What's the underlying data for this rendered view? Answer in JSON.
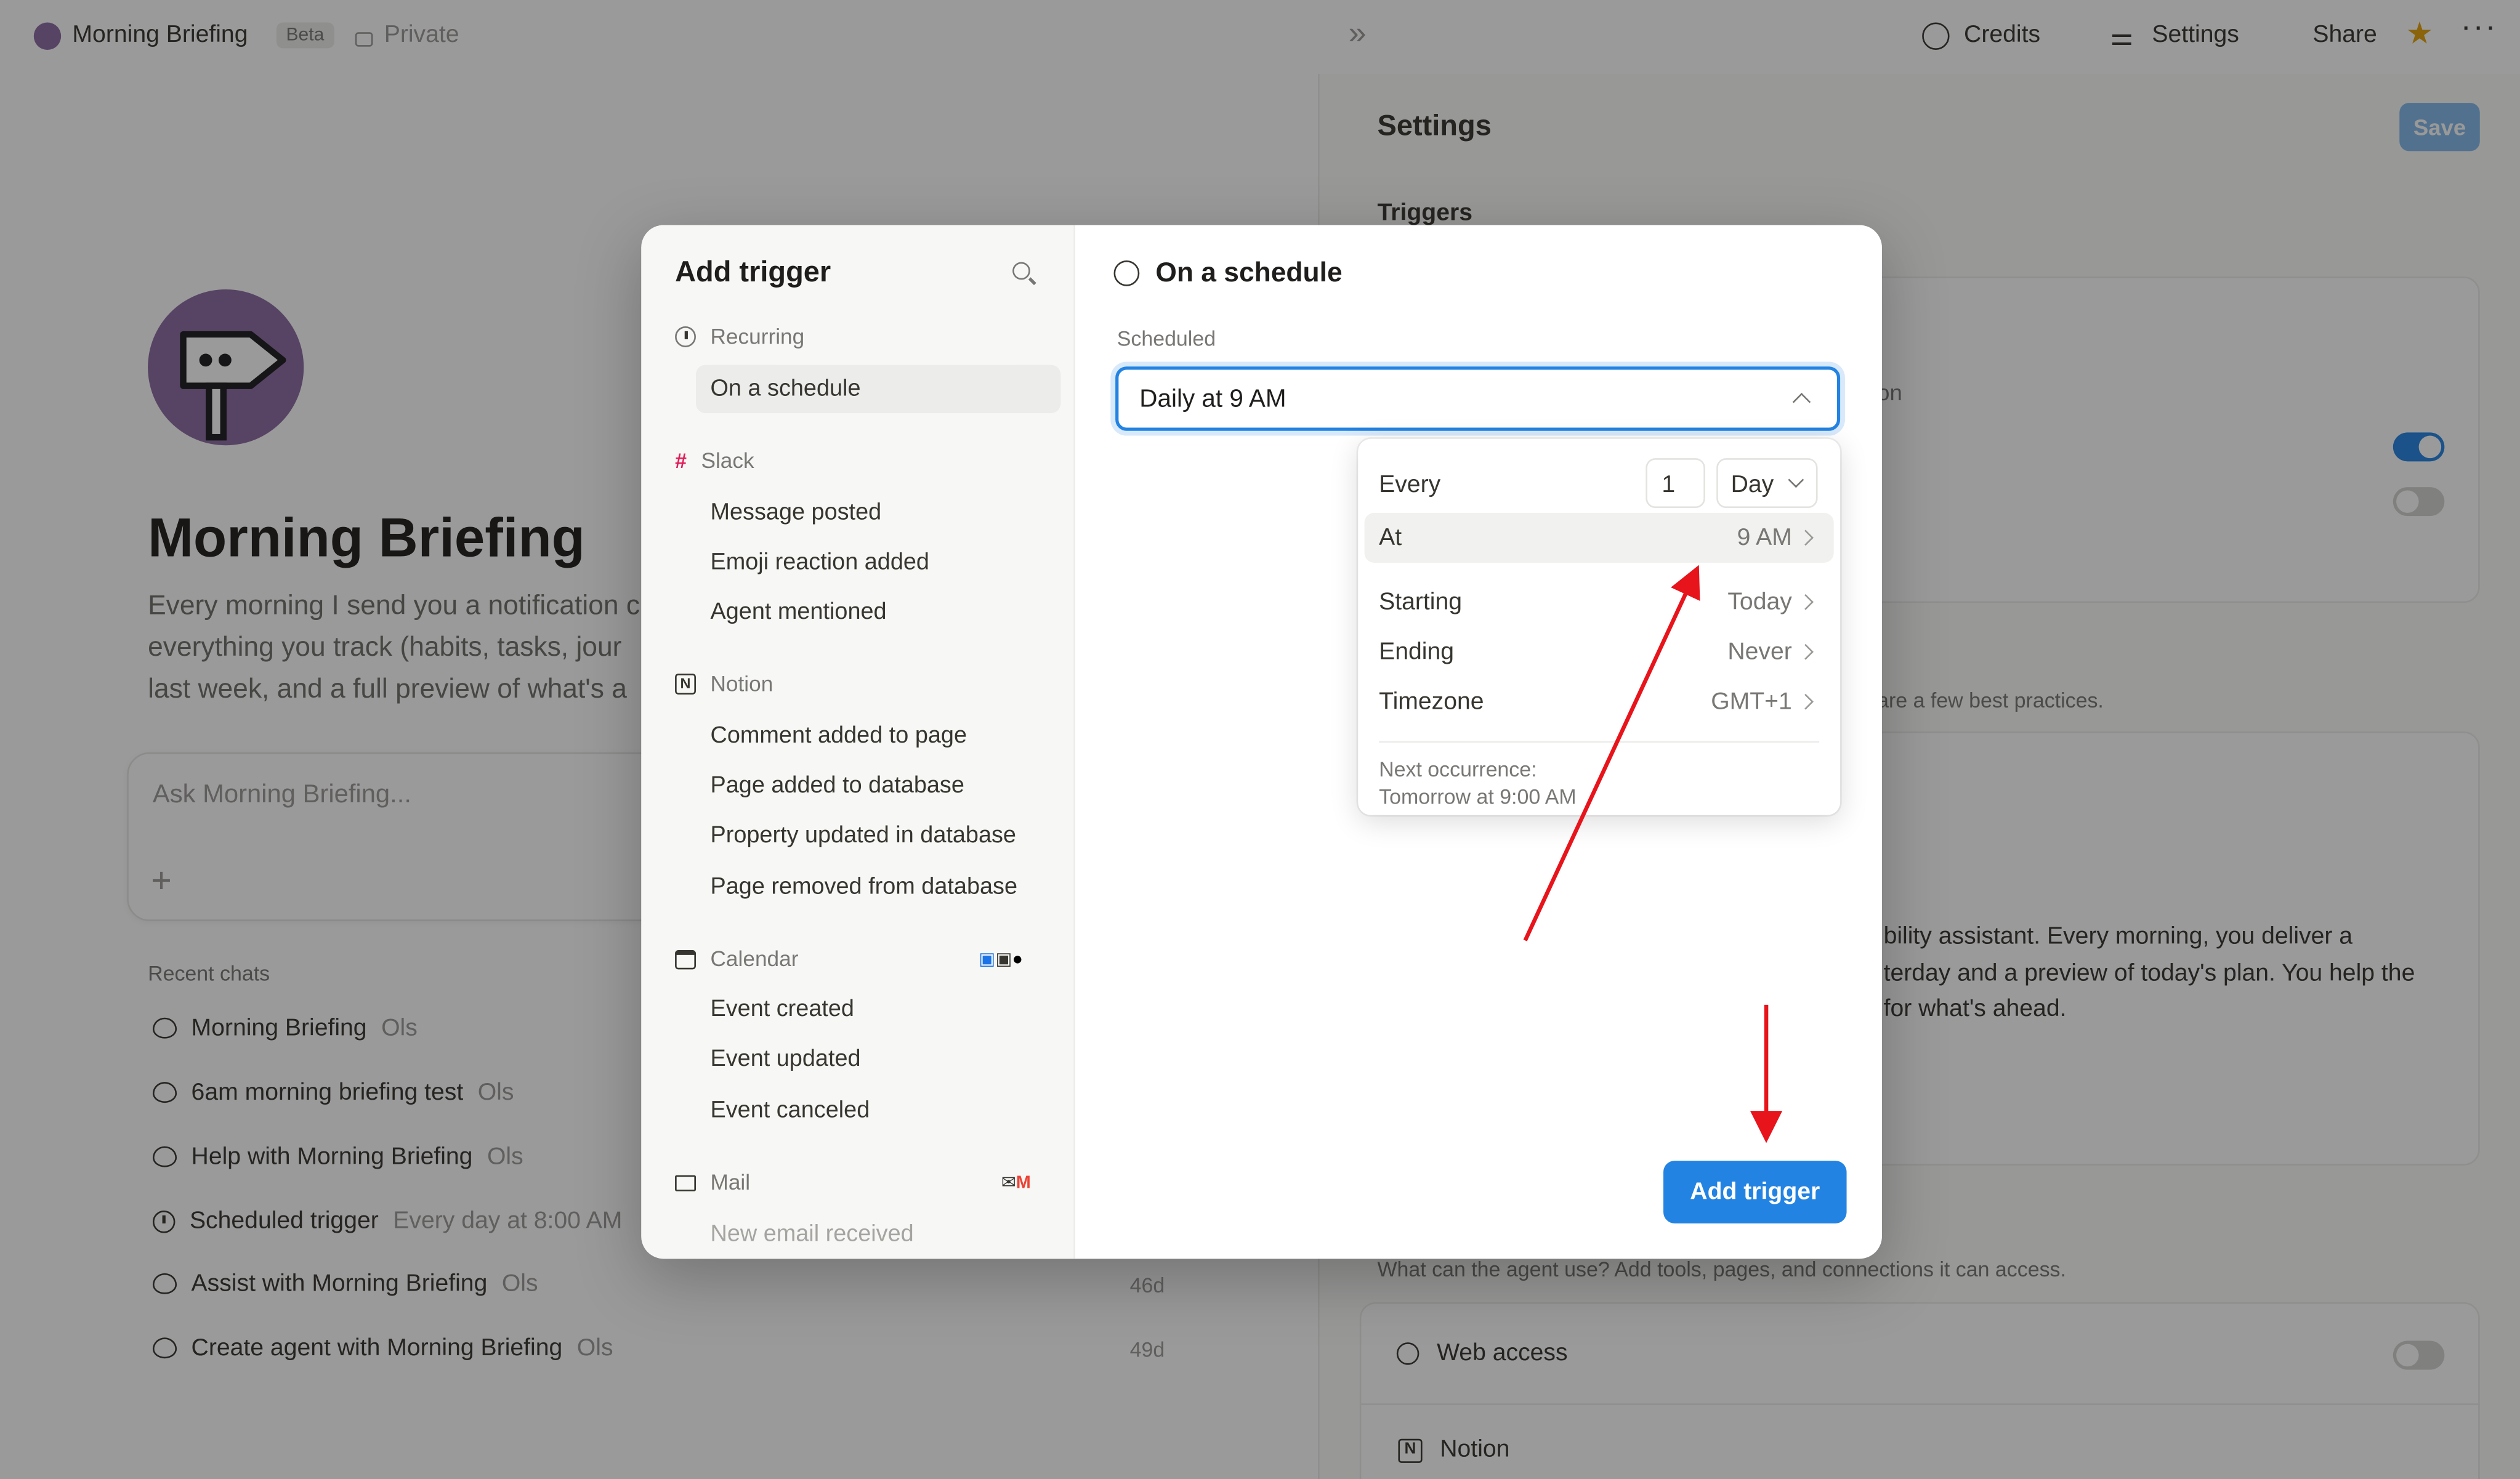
{
  "topbar": {
    "title": "Morning Briefing",
    "beta": "Beta",
    "privacy": "Private",
    "credits": "Credits",
    "settings": "Settings",
    "share": "Share"
  },
  "agent": {
    "name": "Morning Briefing",
    "description_lines": [
      "Every morning I send you a notification c",
      "everything you track (habits, tasks, jour",
      "last week, and a full preview of what's a"
    ],
    "ask_placeholder": "Ask Morning Briefing..."
  },
  "recent_chats": {
    "heading": "Recent chats",
    "items": [
      {
        "title": "Morning Briefing",
        "sub": "Ols",
        "age": "",
        "icon": "chat-bubble-icon"
      },
      {
        "title": "6am morning briefing test",
        "sub": "Ols",
        "age": "",
        "icon": "chat-bubble-icon"
      },
      {
        "title": "Help with Morning Briefing",
        "sub": "Ols",
        "age": "",
        "icon": "chat-bubble-icon"
      },
      {
        "title": "Scheduled trigger",
        "sub": "Every day at 8:00 AM",
        "age": "",
        "icon": "clock-icon"
      },
      {
        "title": "Assist with Morning Briefing",
        "sub": "Ols",
        "age": "46d",
        "icon": "chat-bubble-icon"
      },
      {
        "title": "Create agent with Morning Briefing",
        "sub": "Ols",
        "age": "49d",
        "icon": "chat-bubble-icon"
      }
    ]
  },
  "settings_panel": {
    "title": "Settings",
    "save": "Save",
    "triggers": "Triggers",
    "partial_on": "on",
    "best_practices": "are a few best practices.",
    "instruction_lines": [
      "bility assistant. Every morning, you deliver a",
      "terday and a preview of today's plan. You help the",
      "for what's ahead."
    ],
    "tools_help": "What can the agent use? Add tools, pages, and connections it can access.",
    "web_access": "Web access",
    "notion": "Notion",
    "toggles": [
      true,
      false
    ]
  },
  "modal": {
    "title": "Add trigger",
    "sections": [
      {
        "name": "Recurring",
        "icon": "clock-icon",
        "items": [
          "On a schedule"
        ]
      },
      {
        "name": "Slack",
        "icon": "slack-icon",
        "items": [
          "Message posted",
          "Emoji reaction added",
          "Agent mentioned"
        ]
      },
      {
        "name": "Notion",
        "icon": "notion-icon",
        "items": [
          "Comment added to page",
          "Page added to database",
          "Property updated in database",
          "Page removed from database"
        ]
      },
      {
        "name": "Calendar",
        "icon": "calendar-icon",
        "items": [
          "Event created",
          "Event updated",
          "Event canceled"
        ]
      },
      {
        "name": "Mail",
        "icon": "mail-icon",
        "items": [
          "New email received"
        ]
      }
    ],
    "selected_item": "On a schedule",
    "detail_title": "On a schedule",
    "scheduled_label": "Scheduled",
    "scheduled_value": "Daily at 9 AM",
    "schedule": {
      "every_label": "Every",
      "every_count": "1",
      "every_unit": "Day",
      "at_label": "At",
      "at_value": "9 AM",
      "starting_label": "Starting",
      "starting_value": "Today",
      "ending_label": "Ending",
      "ending_value": "Never",
      "timezone_label": "Timezone",
      "timezone_value": "GMT+1",
      "next_label": "Next occurrence:",
      "next_value": "Tomorrow at 9:00 AM"
    },
    "add_button": "Add trigger"
  },
  "colors": {
    "accent": "#2383e2",
    "annotation_arrow": "#e8141b",
    "avatar_bg": "#8c6ba3"
  }
}
